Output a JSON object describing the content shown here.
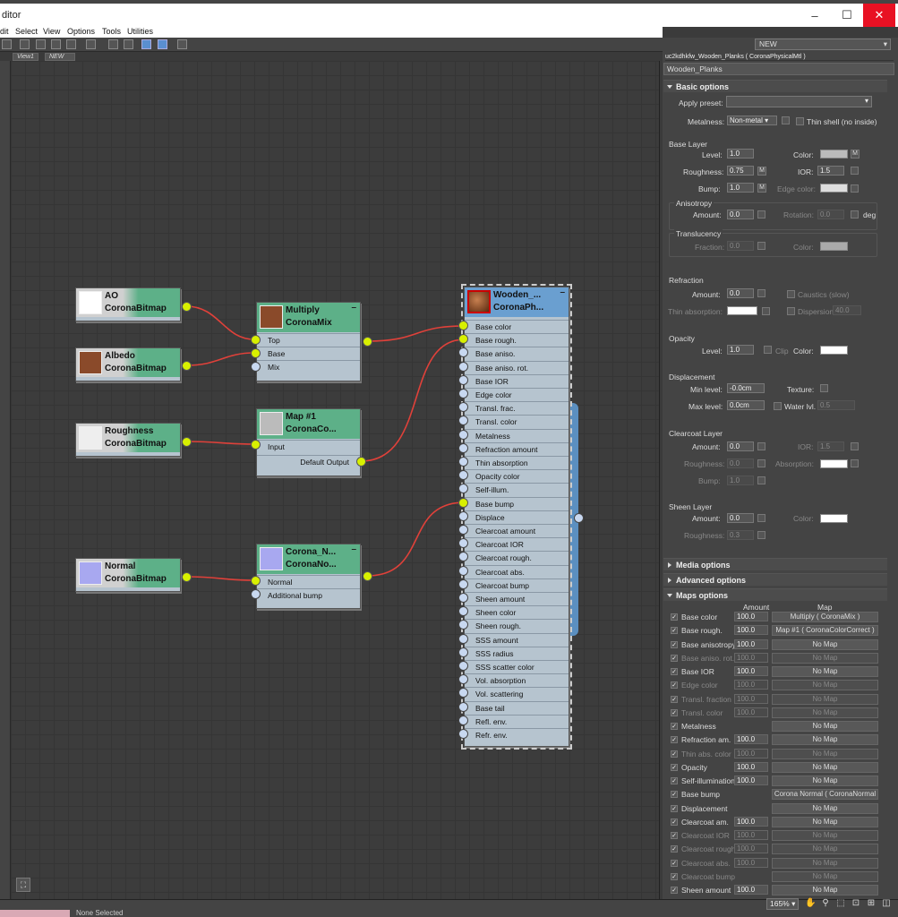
{
  "window": {
    "title": "ditor",
    "min": "–",
    "max": "☐",
    "close": "✕"
  },
  "menu": [
    "dit",
    "Select",
    "View",
    "Options",
    "Tools",
    "Utilities"
  ],
  "tabs": [
    "View1",
    "NEW"
  ],
  "nodes": {
    "ao": {
      "title": "AO",
      "type": "CoronaBitmap"
    },
    "albedo": {
      "title": "Albedo",
      "type": "CoronaBitmap"
    },
    "roughness": {
      "title": "Roughness",
      "type": "CoronaBitmap"
    },
    "normal": {
      "title": "Normal",
      "type": "CoronaBitmap"
    },
    "multiply": {
      "title": "Multiply",
      "type": "CoronaMix",
      "slots": [
        "Top",
        "Base",
        "Mix"
      ]
    },
    "map1": {
      "title": "Map #1",
      "type": "CoronaCo...",
      "slots": [
        "Input",
        "Default Output"
      ]
    },
    "corona_normal": {
      "title": "Corona_N...",
      "type": "CoronaNo...",
      "slots": [
        "Normal",
        "Additional bump"
      ]
    },
    "material": {
      "title": "Wooden_...",
      "type": "CoronaPh...",
      "slots": [
        "Base color",
        "Base rough.",
        "Base aniso.",
        "Base aniso. rot.",
        "Base IOR",
        "Edge color",
        "Transl. frac.",
        "Transl. color",
        "Metalness",
        "Refraction amount",
        "Thin absorption",
        "Opacity color",
        "Self-illum.",
        "Base bump",
        "Displace",
        "Clearcoat amount",
        "Clearcoat IOR",
        "Clearcoat rough.",
        "Clearcoat abs.",
        "Clearcoat bump",
        "Sheen amount",
        "Sheen color",
        "Sheen rough.",
        "SSS amount",
        "SSS radius",
        "SSS scatter color",
        "Vol. absorption",
        "Vol. scattering",
        "Base tail",
        "Refl. env.",
        "Refr. env."
      ]
    }
  },
  "panel": {
    "dropdown": "NEW",
    "mat_header": "uc2kdhkfw_Wooden_Planks  ( CoronaPhysicalMtl )",
    "mat_name": "Wooden_Planks",
    "basic_options": "Basic options",
    "apply_preset": "Apply preset:",
    "metalness_label": "Metalness:",
    "metalness_value": "Non-metal",
    "thin_shell": "Thin shell (no inside)",
    "base_layer": "Base Layer",
    "level_label": "Level:",
    "level_value": "1.0",
    "color_label": "Color:",
    "roughness_label": "Roughness:",
    "roughness_value": "0.75",
    "ior_label": "IOR:",
    "ior_value": "1.5",
    "bump_label": "Bump:",
    "bump_value": "1.0",
    "edge_color_label": "Edge color:",
    "anisotropy": "Anisotropy",
    "amount_label": "Amount:",
    "aniso_amount": "0.0",
    "rotation_label": "Rotation:",
    "rotation_value": "0.0",
    "deg": "deg",
    "translucency": "Translucency",
    "fraction_label": "Fraction:",
    "fraction_value": "0.0",
    "refraction": "Refraction",
    "refr_amount": "0.0",
    "caustics": "Caustics (slow)",
    "thin_absorption_label": "Thin absorption:",
    "dispersion_label": "Dispersion",
    "dispersion_value": "40.0",
    "opacity": "Opacity",
    "opacity_level": "1.0",
    "clip": "Clip",
    "displacement": "Displacement",
    "min_level_label": "Min level:",
    "min_level_value": "-0.0cm",
    "texture_label": "Texture:",
    "max_level_label": "Max level:",
    "max_level_value": "0.0cm",
    "water_lvl": "Water lvl.",
    "water_value": "0.5",
    "clearcoat": "Clearcoat Layer",
    "cc_amount": "0.0",
    "cc_ior": "1.5",
    "cc_roughness_label": "Roughness:",
    "cc_roughness": "0.0",
    "absorption_label": "Absorption:",
    "cc_bump": "1.0",
    "sheen": "Sheen Layer",
    "sheen_amount": "0.0",
    "sheen_roughness": "0.3",
    "media_options": "Media options",
    "advanced_options": "Advanced options",
    "maps_options": "Maps options",
    "amount_col": "Amount",
    "map_col": "Map"
  },
  "maps": [
    {
      "label": "Base color",
      "checked": true,
      "enabled": true,
      "amount": "100.0",
      "map": "Multiply  ( CoronaMix )"
    },
    {
      "label": "Base rough.",
      "checked": true,
      "enabled": true,
      "amount": "100.0",
      "map": "Map #1  ( CoronaColorCorrect )"
    },
    {
      "label": "Base anisotropy",
      "checked": true,
      "enabled": true,
      "amount": "100.0",
      "map": "No Map"
    },
    {
      "label": "Base aniso. rot.",
      "checked": true,
      "enabled": false,
      "amount": "100.0",
      "map": "No Map"
    },
    {
      "label": "Base IOR",
      "checked": true,
      "enabled": true,
      "amount": "100.0",
      "map": "No Map"
    },
    {
      "label": "Edge color",
      "checked": true,
      "enabled": false,
      "amount": "100.0",
      "map": "No Map"
    },
    {
      "label": "Transl. fraction",
      "checked": true,
      "enabled": false,
      "amount": "100.0",
      "map": "No Map"
    },
    {
      "label": "Transl. color",
      "checked": true,
      "enabled": false,
      "amount": "100.0",
      "map": "No Map"
    },
    {
      "label": "Metalness",
      "checked": true,
      "enabled": true,
      "amount": "",
      "map": "No Map"
    },
    {
      "label": "Refraction am.",
      "checked": true,
      "enabled": true,
      "amount": "100.0",
      "map": "No Map"
    },
    {
      "label": "Thin abs. color",
      "checked": true,
      "enabled": false,
      "amount": "100.0",
      "map": "No Map"
    },
    {
      "label": "Opacity",
      "checked": true,
      "enabled": true,
      "amount": "100.0",
      "map": "No Map"
    },
    {
      "label": "Self-illumination",
      "checked": true,
      "enabled": true,
      "amount": "100.0",
      "map": "No Map"
    },
    {
      "label": "Base bump",
      "checked": true,
      "enabled": true,
      "amount": "",
      "map": "Corona Normal  ( CoronaNormal"
    },
    {
      "label": "Displacement",
      "checked": true,
      "enabled": true,
      "amount": "",
      "map": "No Map"
    },
    {
      "label": "Clearcoat am.",
      "checked": true,
      "enabled": true,
      "amount": "100.0",
      "map": "No Map"
    },
    {
      "label": "Clearcoat IOR",
      "checked": true,
      "enabled": false,
      "amount": "100.0",
      "map": "No Map"
    },
    {
      "label": "Clearcoat rough.",
      "checked": true,
      "enabled": false,
      "amount": "100.0",
      "map": "No Map"
    },
    {
      "label": "Clearcoat abs.",
      "checked": true,
      "enabled": false,
      "amount": "100.0",
      "map": "No Map"
    },
    {
      "label": "Clearcoat bump",
      "checked": true,
      "enabled": false,
      "amount": "",
      "map": "No Map"
    },
    {
      "label": "Sheen amount",
      "checked": true,
      "enabled": true,
      "amount": "100.0",
      "map": "No Map"
    }
  ],
  "status": {
    "selected": "None Selected",
    "zoom": "165%"
  },
  "icons": {
    "hand": "hand-icon",
    "zoom": "magnify-icon",
    "node_nav": "navigator-icon"
  },
  "colors": {
    "accent": "#5a8fd0",
    "node_head": "#5db088",
    "material_head": "#5b8fc0",
    "socket_on": "#d8f000",
    "wire": "#e0413a"
  }
}
